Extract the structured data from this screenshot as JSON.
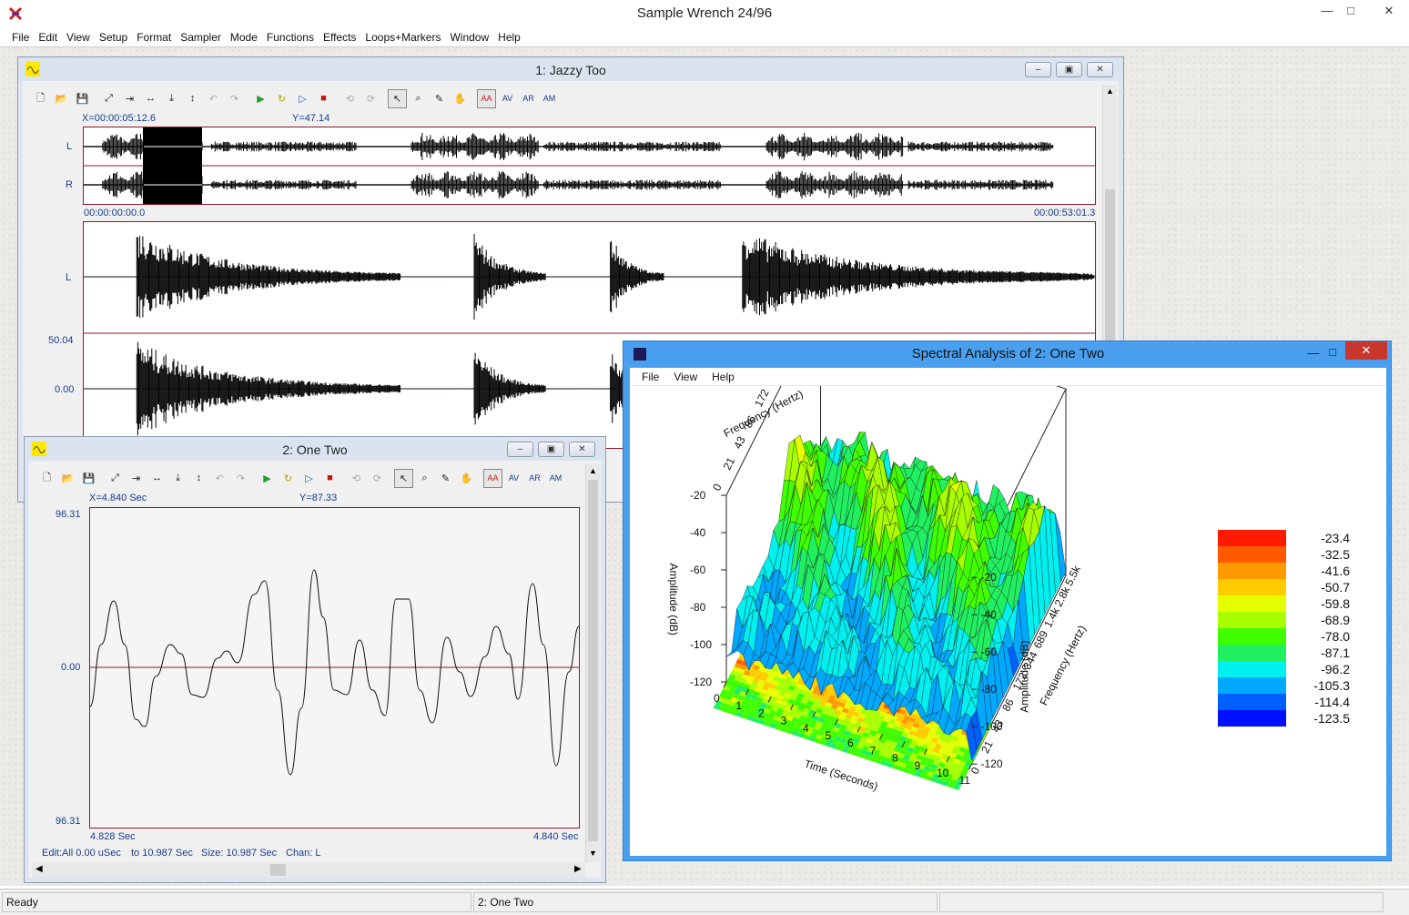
{
  "app": {
    "title": "Sample Wrench 24/96"
  },
  "controls": {
    "minimize": "—",
    "maximize": "□",
    "close": "✕",
    "child_min": "–",
    "child_max": "▣",
    "child_close": "✕"
  },
  "menu": [
    "File",
    "Edit",
    "View",
    "Setup",
    "Format",
    "Sampler",
    "Mode",
    "Functions",
    "Effects",
    "Loops+Markers",
    "Window",
    "Help"
  ],
  "win1": {
    "title": "1:  Jazzy Too",
    "cursor_x": "X=00:00:05:12.6",
    "cursor_y": "Y=47.14",
    "chan_l": "L",
    "chan_r": "R",
    "time_start": "00:00:00:00.0",
    "time_end": "00:00:53:01.3",
    "zoom_l": "L",
    "y_top": "50.04",
    "y_mid": "0.00"
  },
  "win2": {
    "title": "2:  One Two",
    "cursor_x": "X=4.840 Sec",
    "cursor_y": "Y=87.33",
    "y_top": "96.31",
    "y_mid": "0.00",
    "y_bottom": "96.31",
    "t_start": "4.828 Sec",
    "t_end": "4.840 Sec",
    "info": {
      "edit": "Edit:All  0.00 uSec",
      "to": "to 10.987 Sec",
      "size": "Size: 10.987 Sec",
      "chan": "Chan: L"
    }
  },
  "toolbar_icons": [
    "new-file-icon",
    "open-folder-icon",
    "save-icon",
    "zoom-full-icon",
    "zoom-in-h-icon",
    "zoom-out-h-icon",
    "zoom-in-v-icon",
    "zoom-out-v-icon",
    "undo-zoom-icon",
    "redo-zoom-icon",
    "play-all-icon",
    "play-loop-icon",
    "play-selection-icon",
    "stop-icon",
    "undo-icon",
    "redo-icon",
    "pointer-icon",
    "magnify-icon",
    "pencil-icon",
    "hand-icon",
    "amp-a-icon",
    "amp-v-icon",
    "amp-r-icon",
    "amp-m-icon"
  ],
  "toolbar_text": {
    "aa": "AA",
    "av": "AV",
    "ar": "AR",
    "am": "AM"
  },
  "spectral": {
    "title": "Spectral Analysis of  2:  One Two",
    "menu": [
      "File",
      "View",
      "Help"
    ]
  },
  "status": {
    "left": "Ready",
    "middle": "2:  One Two"
  },
  "chart_data": {
    "type": "surface3d",
    "x_axis": {
      "label": "Time (Seconds)",
      "ticks": [
        "0",
        "1",
        "2",
        "3",
        "4",
        "5",
        "6",
        "7",
        "8",
        "9",
        "10",
        "11"
      ]
    },
    "y_axis": {
      "label": "Frequency (Hertz)",
      "ticks": [
        "0",
        "21",
        "43",
        "86",
        "172",
        "344",
        "689",
        "1.4k",
        "2.8k",
        "5.5k"
      ]
    },
    "z_axis": {
      "label": "Amplitude (dB)",
      "ticks_left": [
        "-20",
        "-40",
        "-60",
        "-80",
        "-100",
        "-120"
      ],
      "ticks_right": [
        "-20",
        "-40",
        "-60",
        "-80",
        "-100",
        "-120"
      ]
    },
    "legend": {
      "values": [
        "-23.4",
        "-32.5",
        "-41.6",
        "-50.7",
        "-59.8",
        "-68.9",
        "-78.0",
        "-87.1",
        "-96.2",
        "-105.3",
        "-114.4",
        "-123.5"
      ],
      "colors": [
        "#ff1a00",
        "#ff5a00",
        "#ff9a00",
        "#ffcc00",
        "#e6ff00",
        "#a8ff00",
        "#40ff00",
        "#20f060",
        "#00f0f0",
        "#00a8ff",
        "#0060ff",
        "#0010ff"
      ]
    }
  }
}
